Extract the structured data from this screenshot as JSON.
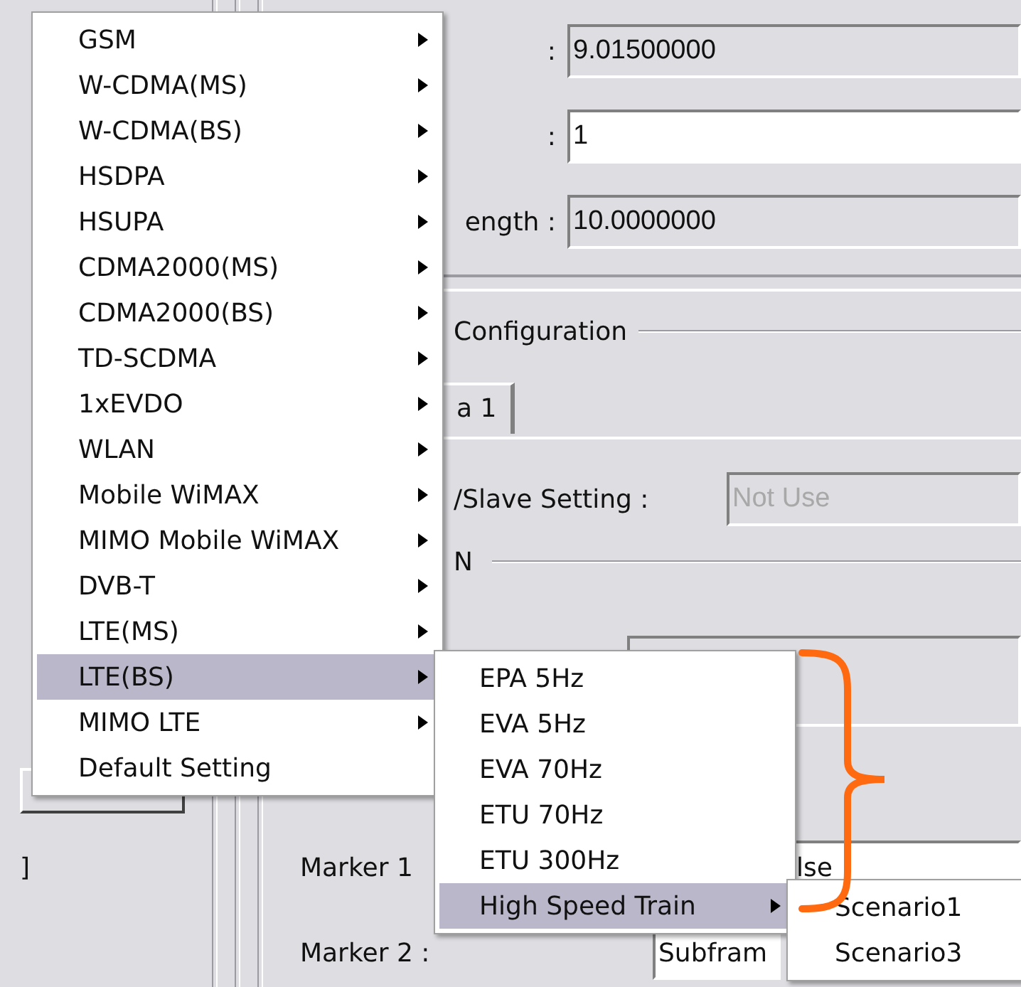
{
  "form": {
    "fields": [
      {
        "label": ":",
        "value": "9.01500000",
        "editable": false
      },
      {
        "label": ":",
        "value": "1",
        "editable": true
      },
      {
        "label": "ength :",
        "value": "10.0000000",
        "editable": false
      }
    ]
  },
  "group": {
    "title": "Configuration",
    "tabs": [
      {
        "label": "a 1",
        "selected": true
      }
    ],
    "slave_setting": {
      "label": "/Slave Setting :",
      "value": "Not Use",
      "disabled": true
    },
    "subgroup_title": "N",
    "markers": [
      {
        "label": "Marker 1",
        "value": "lse"
      },
      {
        "label": "Marker 2 :",
        "value": "Subfram"
      }
    ]
  },
  "left_panel": {
    "bracket": "]"
  },
  "menu": {
    "items": [
      {
        "label": "GSM",
        "has_submenu": true,
        "selected": false
      },
      {
        "label": "W-CDMA(MS)",
        "has_submenu": true,
        "selected": false
      },
      {
        "label": "W-CDMA(BS)",
        "has_submenu": true,
        "selected": false
      },
      {
        "label": "HSDPA",
        "has_submenu": true,
        "selected": false
      },
      {
        "label": "HSUPA",
        "has_submenu": true,
        "selected": false
      },
      {
        "label": "CDMA2000(MS)",
        "has_submenu": true,
        "selected": false
      },
      {
        "label": "CDMA2000(BS)",
        "has_submenu": true,
        "selected": false
      },
      {
        "label": "TD-SCDMA",
        "has_submenu": true,
        "selected": false
      },
      {
        "label": "1xEVDO",
        "has_submenu": true,
        "selected": false
      },
      {
        "label": "WLAN",
        "has_submenu": true,
        "selected": false
      },
      {
        "label": "Mobile WiMAX",
        "has_submenu": true,
        "selected": false
      },
      {
        "label": "MIMO Mobile WiMAX",
        "has_submenu": true,
        "selected": false
      },
      {
        "label": "DVB-T",
        "has_submenu": true,
        "selected": false
      },
      {
        "label": "LTE(MS)",
        "has_submenu": true,
        "selected": false
      },
      {
        "label": "LTE(BS)",
        "has_submenu": true,
        "selected": true,
        "children": [
          {
            "label": "EPA 5Hz",
            "has_submenu": false,
            "selected": false
          },
          {
            "label": "EVA 5Hz",
            "has_submenu": false,
            "selected": false
          },
          {
            "label": "EVA 70Hz",
            "has_submenu": false,
            "selected": false
          },
          {
            "label": "ETU 70Hz",
            "has_submenu": false,
            "selected": false
          },
          {
            "label": "ETU 300Hz",
            "has_submenu": false,
            "selected": false
          },
          {
            "label": "High Speed Train",
            "has_submenu": true,
            "selected": true,
            "children": [
              {
                "label": "Scenario1",
                "has_submenu": false,
                "selected": false
              },
              {
                "label": "Scenario3",
                "has_submenu": false,
                "selected": false
              }
            ]
          }
        ]
      },
      {
        "label": "MIMO LTE",
        "has_submenu": true,
        "selected": false
      },
      {
        "label": "Default Setting",
        "has_submenu": false,
        "selected": false
      }
    ]
  }
}
